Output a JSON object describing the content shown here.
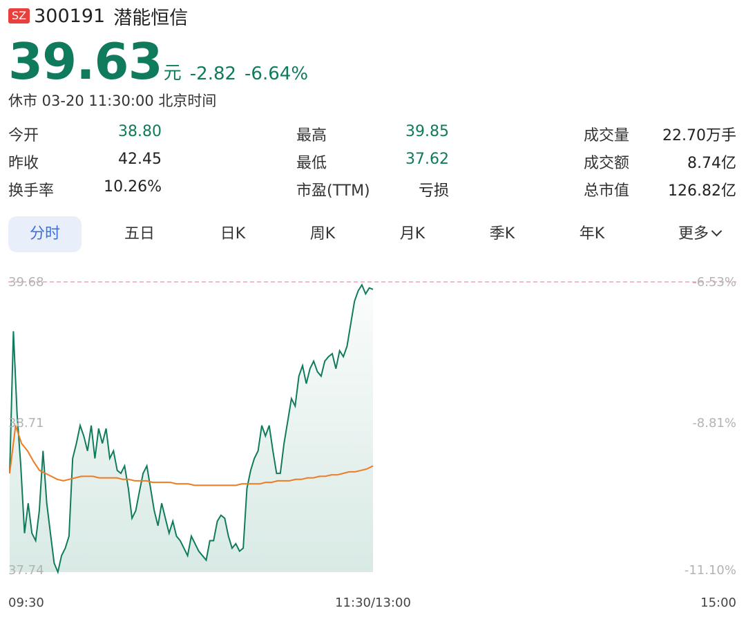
{
  "header": {
    "exchange_badge": "SZ",
    "code": "300191",
    "name": "潜能恒信"
  },
  "quote": {
    "price": "39.63",
    "unit": "元",
    "change": "-2.82",
    "change_pct": "-6.64%",
    "status": "休市 03-20 11:30:00 北京时间"
  },
  "stats": [
    {
      "label": "今开",
      "value": "38.80"
    },
    {
      "label": "最高",
      "value": "39.85"
    },
    {
      "label": "成交量",
      "value": "22.70万手"
    },
    {
      "label": "昨收",
      "value": "42.45"
    },
    {
      "label": "最低",
      "value": "37.62"
    },
    {
      "label": "成交额",
      "value": "8.74亿"
    },
    {
      "label": "换手率",
      "value": "10.26%"
    },
    {
      "label": "市盈(TTM)",
      "value": "亏损"
    },
    {
      "label": "总市值",
      "value": "126.82亿"
    }
  ],
  "tabs": [
    "分时",
    "五日",
    "日K",
    "周K",
    "月K",
    "季K",
    "年K",
    "更多"
  ],
  "colors": {
    "down": "#0f7a5c",
    "avg_line": "#ee7b22",
    "ref_line": "#f0a0b0",
    "badge": "#e8413c",
    "tab_active_bg": "#e8effb",
    "tab_active_text": "#3b6fd9"
  },
  "chart_data": {
    "type": "line",
    "y_left_ticks": [
      "39.68",
      "38.71",
      "37.74"
    ],
    "y_right_ticks": [
      "-6.53%",
      "-8.81%",
      "-11.10%"
    ],
    "x_ticks": [
      "09:30",
      "11:30/13:00",
      "15:00"
    ],
    "ylim": [
      37.74,
      39.68
    ],
    "reference_price": 39.68,
    "series": [
      {
        "values": [
          38.4,
          39.35,
          38.8,
          38.45,
          38.0,
          38.2,
          38.0,
          37.95,
          38.15,
          38.55,
          38.2,
          38.0,
          37.8,
          37.74,
          37.85,
          37.9,
          37.98,
          38.5,
          38.6,
          38.72,
          38.65,
          38.55,
          38.72,
          38.5,
          38.7,
          38.6,
          38.7,
          38.5,
          38.55,
          38.42,
          38.4,
          38.45,
          38.3,
          38.1,
          38.15,
          38.28,
          38.4,
          38.45,
          38.3,
          38.15,
          38.05,
          38.2,
          38.1,
          38.0,
          38.08,
          37.98,
          37.95,
          37.9,
          37.85,
          37.98,
          37.93,
          37.88,
          37.85,
          37.82,
          37.95,
          37.95,
          38.08,
          38.12,
          38.1,
          37.98,
          37.9,
          37.93,
          37.88,
          37.9,
          38.3,
          38.42,
          38.5,
          38.55,
          38.72,
          38.65,
          38.72,
          38.55,
          38.4,
          38.4,
          38.6,
          38.75,
          38.9,
          38.85,
          39.05,
          39.12,
          39.0,
          39.1,
          39.15,
          39.08,
          39.05,
          39.15,
          39.18,
          39.2,
          39.1,
          39.22,
          39.18,
          39.25,
          39.4,
          39.55,
          39.62,
          39.66,
          39.6,
          39.64,
          39.63
        ],
        "color": "#0f7a5c"
      },
      {
        "values": [
          38.4,
          38.72,
          38.6,
          38.55,
          38.48,
          38.42,
          38.4,
          38.38,
          38.36,
          38.35,
          38.36,
          38.37,
          38.38,
          38.38,
          38.38,
          38.37,
          38.37,
          38.37,
          38.37,
          38.36,
          38.36,
          38.35,
          38.35,
          38.35,
          38.34,
          38.34,
          38.34,
          38.34,
          38.33,
          38.33,
          38.33,
          38.32,
          38.32,
          38.32,
          38.32,
          38.32,
          38.32,
          38.32,
          38.32,
          38.33,
          38.33,
          38.33,
          38.33,
          38.34,
          38.34,
          38.35,
          38.35,
          38.35,
          38.36,
          38.36,
          38.37,
          38.37,
          38.38,
          38.38,
          38.39,
          38.39,
          38.4,
          38.41,
          38.41,
          38.42,
          38.43,
          38.45
        ],
        "color": "#ee7b22"
      }
    ]
  }
}
